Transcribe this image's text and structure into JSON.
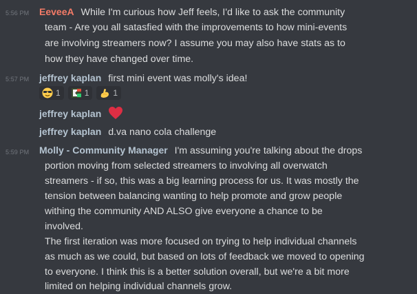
{
  "messages": [
    {
      "timestamp": "5:56 PM",
      "author": "EeveeA",
      "author_color": "#f47b67",
      "lines": [
        "While I'm curious how Jeff feels, I'd like to ask the community",
        "team - Are you all satasfied with the improvements to how mini-events",
        "are involving streamers now? I assume you may also have stats as to",
        "how they have changed over time."
      ]
    },
    {
      "timestamp": "5:57 PM",
      "author": "jeffrey kaplan",
      "author_color": "#b5c4d1",
      "lines": [
        "first mini event was molly's idea!"
      ],
      "reactions": [
        {
          "icon": "sunglasses-face-icon",
          "count": "1"
        },
        {
          "icon": "custom-emoji-icon",
          "count": "1"
        },
        {
          "icon": "flexed-bicep-icon",
          "count": "1"
        }
      ]
    },
    {
      "author": "jeffrey kaplan",
      "heart": "red-heart-icon"
    },
    {
      "author": "jeffrey kaplan",
      "text": "d.va nano cola challenge"
    },
    {
      "timestamp": "5:59 PM",
      "author": "Molly - Community Manager",
      "author_color": "#b5c4d1",
      "first_line": "I'm assuming you're talking about the drops",
      "lines": [
        "portion moving from selected streamers to involving all overwatch",
        "streamers - if so, this was a big learning process for us. It was mostly the",
        "tension between balancing wanting to help promote and grow people",
        "withing the community AND ALSO give everyone a chance to be",
        "involved.",
        "The first iteration was more focused on trying to help individual channels",
        "as much as we could, but based on lots of feedback we moved to opening",
        "to everyone. I think this is a better solution overall, but we're a bit more",
        "limited on helping individual channels grow."
      ]
    }
  ]
}
